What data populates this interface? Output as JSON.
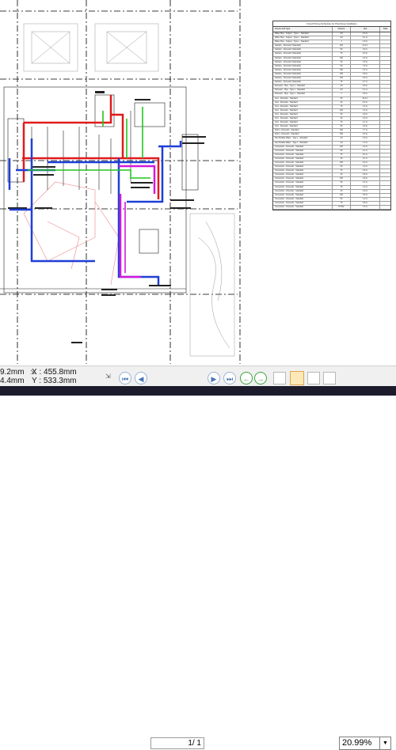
{
  "schedule": {
    "title": "Fixed Pricing Schedule for Plumbing Installation",
    "headers": [
      "Fixture and Type",
      "Volume",
      "Unit",
      "Total"
    ],
    "rows": [
      [
        "Water Pipe - Copper - Type L - Standard",
        "3/4",
        "2.4 m",
        ""
      ],
      [
        "Water Pipe - Copper - Type L - Standard",
        "1/2",
        "5.1 m",
        ""
      ],
      [
        "Water Pipe - Copper - Type L - Standard",
        "1",
        "1.8 m",
        ""
      ],
      [
        "Sanitary - Domestic (Standard)",
        "100",
        "11.2 m",
        ""
      ],
      [
        "Sanitary - Domestic (Standard)",
        "50",
        "3.6 m",
        ""
      ],
      [
        "Sanitary - Domestic (Standard)",
        "75",
        "6.0 m",
        ""
      ],
      [
        "Sanitary - Domestic (Standard)",
        "100",
        "2.2 m",
        ""
      ],
      [
        "Sanitary - Domestic (Standard)",
        "40",
        "1.5 m",
        ""
      ],
      [
        "Sanitary - Domestic (Standard)",
        "50",
        "7.9 m",
        ""
      ],
      [
        "Sanitary - Domestic (Standard)",
        "100",
        "4.4 m",
        ""
      ],
      [
        "Sanitary - Domestic (Standard)",
        "150",
        "0.8 m",
        ""
      ],
      [
        "Sanitary - Domestic (Standard)",
        "100",
        "9.3 m",
        ""
      ],
      [
        "Sanitary - Domestic (Standard)",
        "75",
        "2.7 m",
        ""
      ],
      [
        "Domestic - Pipe - Type L - Standard",
        "1/2",
        "6.5 m",
        ""
      ],
      [
        "Domestic - Pipe - Type L - Standard",
        "3/4",
        "3.1 m",
        ""
      ],
      [
        "Domestic - Pipe - Type L - Standard",
        "1",
        "0.9 m",
        ""
      ],
      [
        "Vent - Domestic - Standard",
        "50",
        "12.4 m",
        ""
      ],
      [
        "Vent - Domestic - Standard",
        "40",
        "5.2 m",
        ""
      ],
      [
        "Vent - Domestic - Standard",
        "75",
        "3.3 m",
        ""
      ],
      [
        "Vent - Domestic - Standard",
        "100",
        "1.6 m",
        ""
      ],
      [
        "Vent - Domestic - Standard",
        "50",
        "2.8 m",
        ""
      ],
      [
        "Vent - Domestic - Standard",
        "40",
        "4.0 m",
        ""
      ],
      [
        "Vent - Domestic - Standard",
        "75",
        "1.1 m",
        ""
      ],
      [
        "Vent - Domestic - Standard",
        "50",
        "3.9 m",
        ""
      ],
      [
        "Storm - Domestic - Standard",
        "100",
        "7.7 m",
        ""
      ],
      [
        "Storm - Domestic - Standard",
        "150",
        "2.5 m",
        ""
      ],
      [
        "Non-Potable Water - Type L - Standard",
        "1/2",
        "4.6 m",
        ""
      ],
      [
        "Non-Potable Water - Type L - Standard",
        "3/4",
        "1.3 m",
        ""
      ],
      [
        "Connection - Domestic - Standard",
        "100",
        "3.0 m",
        ""
      ],
      [
        "Connection - Domestic - Standard",
        "50",
        "2.1 m",
        ""
      ],
      [
        "Connection - Domestic - Standard",
        "75",
        "5.4 m",
        ""
      ],
      [
        "Connection - Domestic - Standard",
        "40",
        "0.7 m",
        ""
      ],
      [
        "Connection - Domestic - Standard",
        "100",
        "6.3 m",
        ""
      ],
      [
        "Connection - Domestic - Standard",
        "50",
        "1.9 m",
        ""
      ],
      [
        "Connection - Domestic - Standard",
        "75",
        "2.6 m",
        ""
      ],
      [
        "Connection - Domestic - Standard",
        "40",
        "3.8 m",
        ""
      ],
      [
        "Connection - Domestic - Standard",
        "100",
        "0.6 m",
        ""
      ],
      [
        "Connection - Domestic - Standard",
        "50",
        "4.2 m",
        ""
      ],
      [
        "Connection - Domestic - Standard",
        "75",
        "1.4 m",
        ""
      ],
      [
        "Connection - Domestic - Standard",
        "40",
        "2.9 m",
        ""
      ],
      [
        "Connection - Domestic - Standard",
        "100",
        "3.5 m",
        ""
      ],
      [
        "Connection - Domestic - Standard",
        "50",
        "1.2 m",
        ""
      ],
      [
        "Connection - Domestic - Standard",
        "75",
        "0.8 m",
        ""
      ],
      [
        "Connection - Domestic - Standard",
        "TOTAL",
        "1.5 m",
        ""
      ]
    ]
  },
  "drawing": {
    "pipe_colors": {
      "sanitary": "#e01b1b",
      "domestic": "#1f3fd6",
      "vent": "#22c41e",
      "storm": "#d21ad8"
    }
  },
  "status": {
    "width_readout": "9.2mm",
    "height_readout": "4.4mm",
    "x_readout": "X : 455.8mm",
    "y_readout": "Y : 533.3mm",
    "page_current": "1",
    "page_total": "/ 1",
    "zoom": "20.99%",
    "zoom_dropdown_icon": "chevron-down-icon"
  }
}
